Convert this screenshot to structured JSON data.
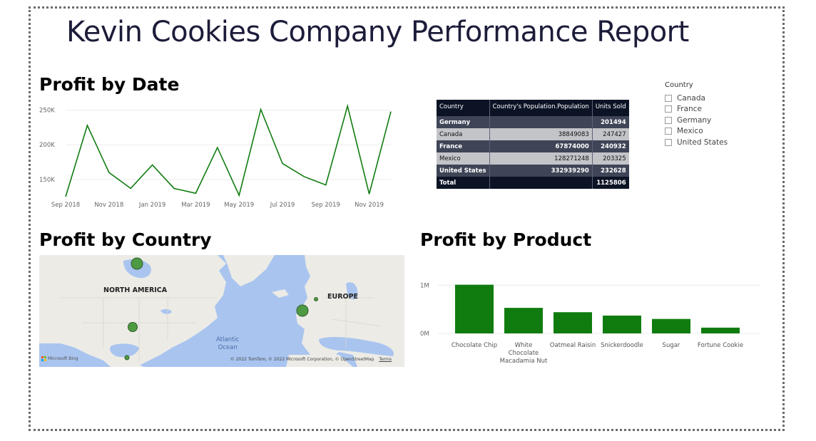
{
  "report": {
    "title": "Kevin Cookies Company Performance Report"
  },
  "sections": {
    "profit_by_date": "Profit by Date",
    "profit_by_country": "Profit by Country",
    "profit_by_product": "Profit by Product"
  },
  "colors": {
    "series": "#107c10",
    "table_dark": "#3f4456",
    "table_light": "#c2c4c8",
    "table_header": "#0c1325"
  },
  "table": {
    "headers": [
      "Country",
      "Country's Population.Population",
      "Units Sold"
    ],
    "rows": [
      [
        "Germany",
        "",
        "201494"
      ],
      [
        "Canada",
        "38849083",
        "247427"
      ],
      [
        "France",
        "67874000",
        "240932"
      ],
      [
        "Mexico",
        "128271248",
        "203325"
      ],
      [
        "United States",
        "332939290",
        "232628"
      ]
    ],
    "total": [
      "Total",
      "",
      "1125806"
    ]
  },
  "slicer": {
    "title": "Country",
    "options": [
      "Canada",
      "France",
      "Germany",
      "Mexico",
      "United States"
    ]
  },
  "map": {
    "labels": {
      "north_america": "NORTH AMERICA",
      "europe": "EUROPE",
      "ocean_line1": "Atlantic",
      "ocean_line2": "Ocean"
    },
    "attribution": "© 2022 TomTom, © 2022 Microsoft Corporation, © OpenStreetMap",
    "terms": "Terms",
    "brand": "Microsoft Bing"
  },
  "chart_data": [
    {
      "type": "line",
      "x_tick_labels": [
        "Sep 2018",
        "Nov 2018",
        "Jan 2019",
        "Mar 2019",
        "May 2019",
        "Jul 2019",
        "Sep 2019",
        "Nov 2019"
      ],
      "y_tick_labels": [
        "250K",
        "200K",
        "150K"
      ],
      "ylim": [
        120000,
        265000
      ],
      "grid": true,
      "series": [
        {
          "values": [
            125000,
            228000,
            160000,
            137000,
            171000,
            137000,
            130000,
            196000,
            127000,
            251000,
            173000,
            154000,
            142000,
            256000,
            129000,
            248000
          ]
        }
      ]
    },
    {
      "type": "bar",
      "categories": [
        "Chocolate Chip",
        "White Chocolate Macadamia Nut",
        "Oatmeal Raisin",
        "Snickerdoodle",
        "Sugar",
        "Fortune Cookie"
      ],
      "category_display": [
        [
          "Chocolate Chip"
        ],
        [
          "White",
          "Chocolate",
          "Macadamia Nut"
        ],
        [
          "Oatmeal Raisin"
        ],
        [
          "Snickerdoodle"
        ],
        [
          "Sugar"
        ],
        [
          "Fortune Cookie"
        ]
      ],
      "values": [
        1010000,
        530000,
        440000,
        370000,
        300000,
        120000
      ],
      "y_tick_labels": [
        "1M",
        "0M"
      ],
      "ylim": [
        0,
        1300000
      ],
      "grid": true
    }
  ]
}
